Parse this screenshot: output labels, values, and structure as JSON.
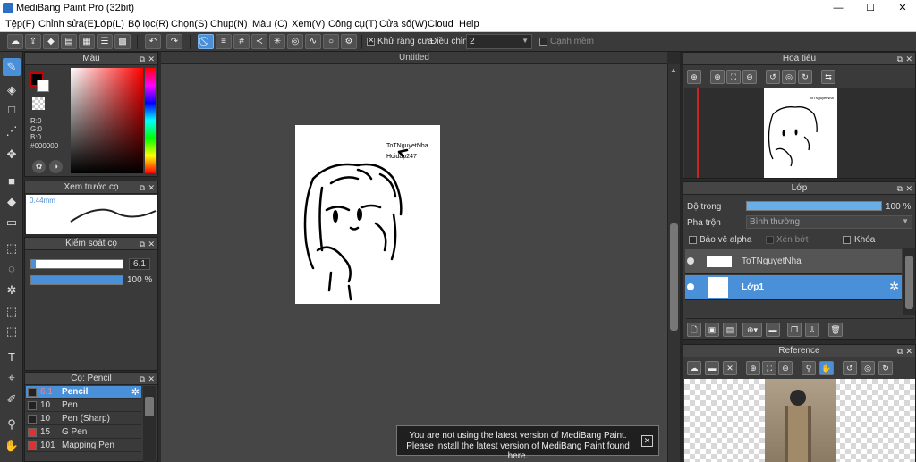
{
  "window": {
    "title": "MediBang Paint Pro (32bit)",
    "min": "—",
    "max": "☐",
    "close": "✕",
    "restore": "□"
  },
  "menu": [
    "Tệp(F)",
    "Chỉnh sửa(E)",
    "Lớp(L)",
    "Bộ lọc(R)",
    "Chọn(S)",
    "Chụp(N)",
    "Màu (C)",
    "Xem(V)",
    "Công cụ(T)",
    "Cửa số(W)",
    "Cloud",
    "Help"
  ],
  "toolbar": {
    "antialias_label": "Khử răng cưa",
    "adjust_label": "Điều chỉnh",
    "adjust_value": "2",
    "edge_label": "Cạnh mềm"
  },
  "color_panel": {
    "title": "Màu",
    "r": "R:0",
    "g": "G:0",
    "b": "B:0",
    "hex": "#000000",
    "fg": "#000000",
    "accent": "#cc0000"
  },
  "brush_preview": {
    "title": "Xem trước cọ",
    "size": "0.44mm"
  },
  "brush_control": {
    "title": "Kiểm soát cọ",
    "size_value": "6.1",
    "opacity_value": "100 %",
    "size_fraction": 0.05,
    "opacity_fraction": 1.0
  },
  "brush_list": {
    "title": "Cọ: Pencil",
    "items": [
      {
        "size": "6.1",
        "name": "Pencil",
        "color": "#222222",
        "active": true
      },
      {
        "size": "10",
        "name": "Pen",
        "color": "#222222"
      },
      {
        "size": "10",
        "name": "Pen (Sharp)",
        "color": "#222222"
      },
      {
        "size": "15",
        "name": "G Pen",
        "color": "#e03030"
      },
      {
        "size": "101",
        "name": "Mapping Pen",
        "color": "#e03030"
      }
    ]
  },
  "canvas": {
    "tab_title": "Untitled",
    "text_line1": "ToTNguyetNha",
    "text_line2": "Hoidap247"
  },
  "navigator": {
    "title": "Hoa tiêu",
    "text_line1": "ToTNguyetNha"
  },
  "layers": {
    "title": "Lớp",
    "opacity_label": "Độ trong",
    "opacity_value": "100 %",
    "opacity_fraction": 1.0,
    "blend_label": "Pha trộn",
    "blend_value": "Bình thường",
    "protect_alpha": "Bảo vệ alpha",
    "clipping": "Xén bớt",
    "lock": "Khóa",
    "items": [
      {
        "name": "ToTNguyetNha",
        "active": false
      },
      {
        "name": "Lớp1",
        "active": true
      }
    ]
  },
  "reference": {
    "title": "Reference"
  },
  "notice": {
    "line1": "You are not using the latest version of MediBang Paint.",
    "line2": "Please install the latest version of MediBang Paint found here.",
    "close": "✕"
  },
  "accent": "#4a90d9"
}
